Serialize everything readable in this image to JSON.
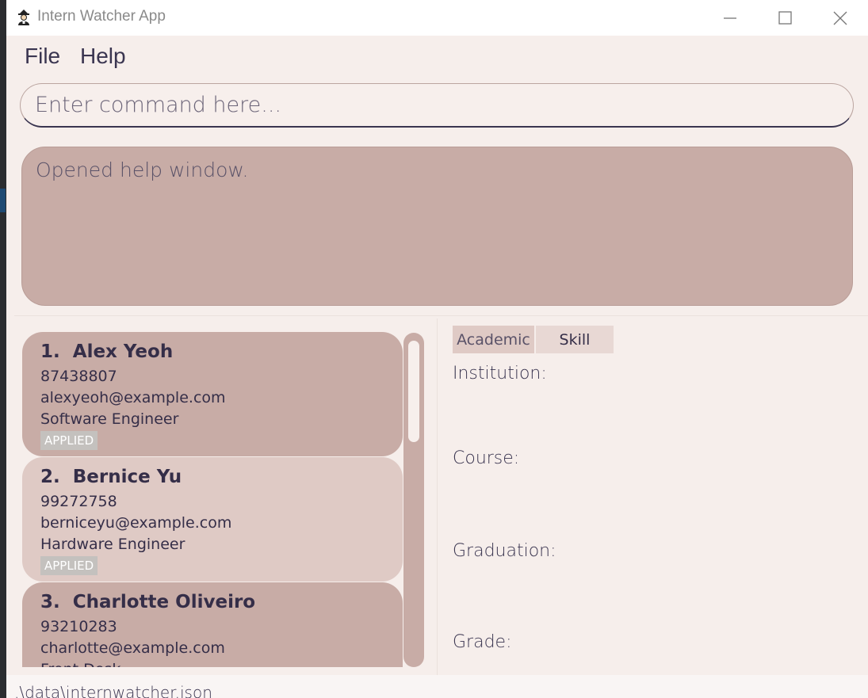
{
  "window": {
    "title": "Intern Watcher App",
    "icon": "detective-icon"
  },
  "menu": {
    "file": "File",
    "help": "Help"
  },
  "command": {
    "placeholder": "Enter command here...",
    "value": ""
  },
  "result": {
    "text": "Opened help window."
  },
  "applicants": [
    {
      "index": "1.",
      "name": "Alex Yeoh",
      "phone": "87438807",
      "email": "alexyeoh@example.com",
      "role": "Software Engineer",
      "status": "APPLIED"
    },
    {
      "index": "2.",
      "name": "Bernice Yu",
      "phone": "99272758",
      "email": "berniceyu@example.com",
      "role": "Hardware Engineer",
      "status": "APPLIED"
    },
    {
      "index": "3.",
      "name": "Charlotte Oliveiro",
      "phone": "93210283",
      "email": "charlotte@example.com",
      "role": "Front Desk",
      "status": ""
    }
  ],
  "details": {
    "tabs": [
      "Academic",
      "Skill"
    ],
    "active_tab": "Academic",
    "fields": [
      "Institution:",
      "Course:",
      "Graduation:",
      "Grade:"
    ]
  },
  "status_bar": {
    "path": ".\\data\\internwatcher.json"
  },
  "colors": {
    "card_dark": "#c8aca6",
    "card_light": "#dfcac5",
    "background": "#f6eeeb",
    "text": "#352e48"
  }
}
